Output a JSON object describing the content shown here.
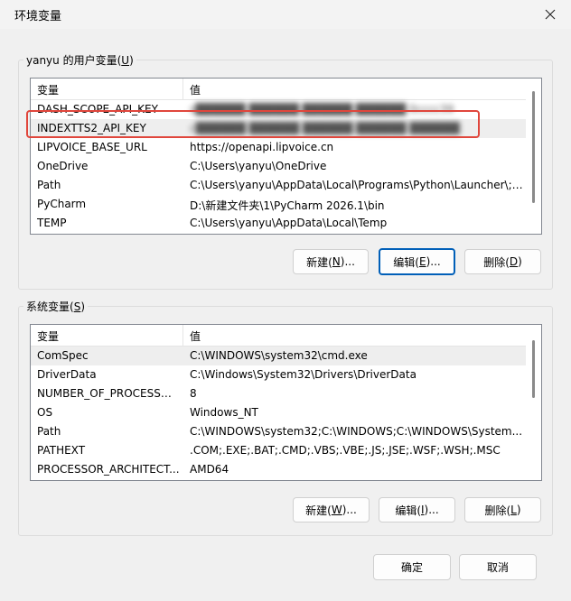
{
  "window": {
    "title": "环境变量"
  },
  "user_group": {
    "label_prefix": "yanyu 的用户变量(",
    "label_key": "U",
    "label_suffix": ")",
    "header": {
      "var": "变量",
      "value": "值"
    },
    "rows": [
      {
        "name": "DASH_SCOPE_API_KEY",
        "value": "s██████ ██████ ██████ ██████ 0cccc39"
      },
      {
        "name": "INDEXTTS2_API_KEY",
        "value": "c██████ ██████ ██████ ██████ ██████"
      },
      {
        "name": "LIPVOICE_BASE_URL",
        "value": "https://openapi.lipvoice.cn"
      },
      {
        "name": "OneDrive",
        "value": "C:\\Users\\yanyu\\OneDrive"
      },
      {
        "name": "Path",
        "value": "C:\\Users\\yanyu\\AppData\\Local\\Programs\\Python\\Launcher\\;C..."
      },
      {
        "name": "PyCharm",
        "value": "D:\\新建文件夹\\1\\PyCharm 2026.1\\bin"
      },
      {
        "name": "TEMP",
        "value": "C:\\Users\\yanyu\\AppData\\Local\\Temp"
      }
    ],
    "buttons": {
      "new": {
        "pre": "新建(",
        "key": "N",
        "post": ")..."
      },
      "edit": {
        "pre": "编辑(",
        "key": "E",
        "post": ")..."
      },
      "delete": {
        "pre": "删除(",
        "key": "D",
        "post": ")"
      }
    }
  },
  "system_group": {
    "label_prefix": "系统变量(",
    "label_key": "S",
    "label_suffix": ")",
    "header": {
      "var": "变量",
      "value": "值"
    },
    "rows": [
      {
        "name": "ComSpec",
        "value": "C:\\WINDOWS\\system32\\cmd.exe"
      },
      {
        "name": "DriverData",
        "value": "C:\\Windows\\System32\\Drivers\\DriverData"
      },
      {
        "name": "NUMBER_OF_PROCESSORS",
        "value": "8"
      },
      {
        "name": "OS",
        "value": "Windows_NT"
      },
      {
        "name": "Path",
        "value": "C:\\WINDOWS\\system32;C:\\WINDOWS;C:\\WINDOWS\\System..."
      },
      {
        "name": "PATHEXT",
        "value": ".COM;.EXE;.BAT;.CMD;.VBS;.VBE;.JS;.JSE;.WSF;.WSH;.MSC"
      },
      {
        "name": "PROCESSOR_ARCHITECT...",
        "value": "AMD64"
      }
    ],
    "buttons": {
      "new": {
        "pre": "新建(",
        "key": "W",
        "post": ")..."
      },
      "edit": {
        "pre": "编辑(",
        "key": "I",
        "post": ")..."
      },
      "delete": {
        "pre": "删除(",
        "key": "L",
        "post": ")"
      }
    }
  },
  "footer": {
    "ok": "确定",
    "cancel": "取消"
  },
  "colors": {
    "focus_border": "#005fb8",
    "annotation_box": "#e0463c",
    "selected_row": "#eeeeee"
  },
  "icons": {
    "close": "close-icon"
  }
}
